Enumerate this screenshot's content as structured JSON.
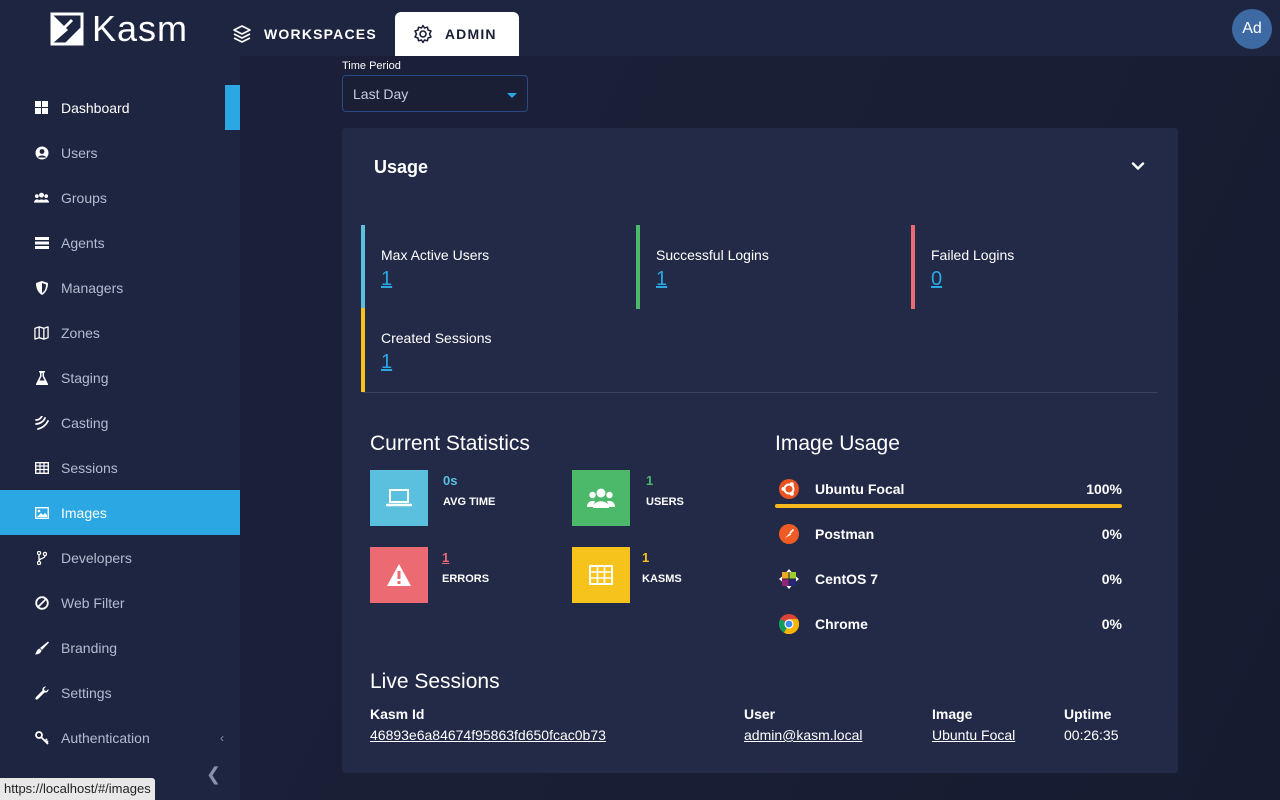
{
  "app": {
    "logo_text": "Kasm",
    "avatar_initials": "Ad"
  },
  "topnav": [
    {
      "label": "WORKSPACES",
      "icon": "layers-icon",
      "active": false
    },
    {
      "label": "ADMIN",
      "icon": "gear-icon",
      "active": true
    }
  ],
  "sidebar": {
    "items": [
      {
        "label": "Dashboard",
        "icon": "dashboard-icon"
      },
      {
        "label": "Users",
        "icon": "user-circle-icon"
      },
      {
        "label": "Groups",
        "icon": "users-icon"
      },
      {
        "label": "Agents",
        "icon": "server-icon"
      },
      {
        "label": "Managers",
        "icon": "shield-icon"
      },
      {
        "label": "Zones",
        "icon": "map-icon"
      },
      {
        "label": "Staging",
        "icon": "flask-icon"
      },
      {
        "label": "Casting",
        "icon": "cast-icon"
      },
      {
        "label": "Sessions",
        "icon": "table-icon"
      },
      {
        "label": "Images",
        "icon": "image-icon"
      },
      {
        "label": "Developers",
        "icon": "branch-icon"
      },
      {
        "label": "Web Filter",
        "icon": "ban-icon"
      },
      {
        "label": "Branding",
        "icon": "brush-icon"
      },
      {
        "label": "Settings",
        "icon": "wrench-icon"
      },
      {
        "label": "Authentication",
        "icon": "key-icon"
      }
    ],
    "current": "Dashboard",
    "hovered": "Images"
  },
  "status_url": "https://localhost/#/images",
  "time_period": {
    "label": "Time Period",
    "value": "Last Day"
  },
  "usage": {
    "title": "Usage",
    "metrics": [
      {
        "label": "Max Active Users",
        "value": "1",
        "color": "#5bc0de"
      },
      {
        "label": "Successful Logins",
        "value": "1",
        "color": "#4cb86a"
      },
      {
        "label": "Failed Logins",
        "value": "0",
        "color": "#ec6b73"
      },
      {
        "label": "Created Sessions",
        "value": "1",
        "color": "#f6c21c"
      }
    ]
  },
  "current_statistics": {
    "title": "Current Statistics",
    "stats": [
      {
        "value": "0s",
        "label": "AVG TIME",
        "color": "#5bc0de",
        "icon": "laptop-icon"
      },
      {
        "value": "1",
        "label": "USERS",
        "color": "#4cb86a",
        "icon": "users-icon"
      },
      {
        "value": "1",
        "label": "ERRORS",
        "color": "#ec6b73",
        "icon": "warning-icon"
      },
      {
        "value": "1",
        "label": "KASMS",
        "color": "#f6c21c",
        "icon": "grid-icon"
      }
    ]
  },
  "image_usage": {
    "title": "Image Usage",
    "items": [
      {
        "name": "Ubuntu Focal",
        "percent": "100%",
        "icon": "ubuntu-icon",
        "fraction": 1.0
      },
      {
        "name": "Postman",
        "percent": "0%",
        "icon": "postman-icon",
        "fraction": 0
      },
      {
        "name": "CentOS 7",
        "percent": "0%",
        "icon": "centos-icon",
        "fraction": 0
      },
      {
        "name": "Chrome",
        "percent": "0%",
        "icon": "chrome-icon",
        "fraction": 0
      }
    ]
  },
  "live_sessions": {
    "title": "Live Sessions",
    "columns": [
      "Kasm Id",
      "User",
      "Image",
      "Uptime"
    ],
    "rows": [
      [
        "46893e6a84674f95863fd650fcac0b73",
        "admin@kasm.local",
        "Ubuntu Focal",
        "00:26:35"
      ]
    ]
  }
}
